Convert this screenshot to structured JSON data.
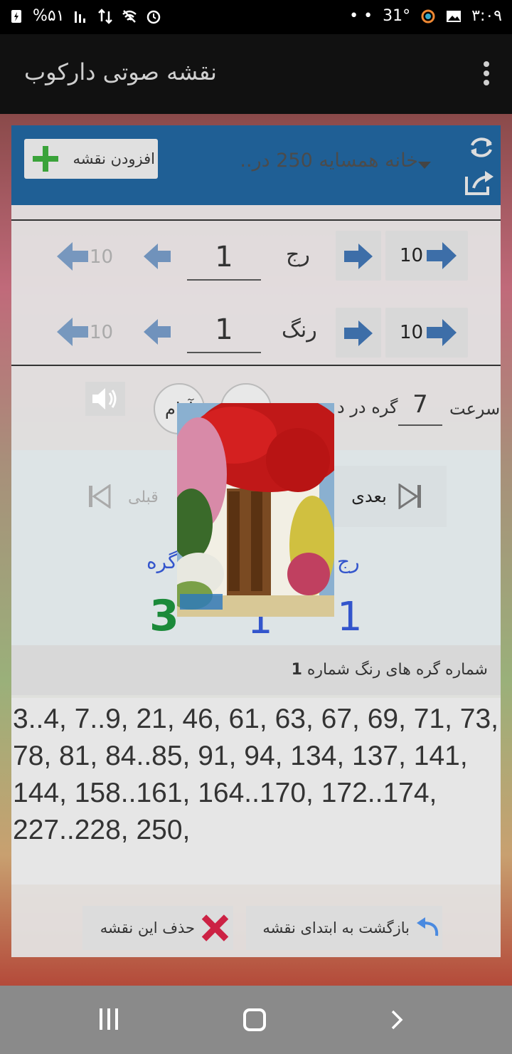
{
  "status_bar": {
    "battery": "%۵۱",
    "time": "۳:۰۹",
    "temperature": "31°",
    "dots": "• •"
  },
  "app_bar": {
    "title": "نقشه صوتی دارکوب"
  },
  "toolbar": {
    "add_map_label": "افزودن نقشه",
    "selected_map": "خانه همسایه  250 در..",
    "accent_color": "#1f5f95"
  },
  "row_control": {
    "label": "رج",
    "value": "1",
    "step_left": "10",
    "step_right": "10"
  },
  "color_control": {
    "label": "رنگ",
    "value": "1",
    "step_left": "10",
    "step_right": "10"
  },
  "speed": {
    "label": "سرعت",
    "value": "7",
    "unit_label": "گره در د",
    "slow_label": "آرام"
  },
  "navigation": {
    "next_label": "بعدی",
    "prev_label": "قبلی"
  },
  "position": {
    "row_heading": "رج",
    "knot_heading": "گره",
    "knot_value": "3",
    "mid_value": "1",
    "row_value": "1"
  },
  "knot_info": {
    "label": "شماره گره های رنگ شماره",
    "color_number": "1"
  },
  "knot_list": {
    "text": "3..4, 7..9, 21, 46, 61, 63, 67, 69, 71, 73, 78, 81, 84..85, 91, 94, 134, 137, 141, 144, 158..161, 164..170, 172..174, 227..228, 250,"
  },
  "footer": {
    "delete_label": "حذف این نقشه",
    "restart_label": "بازگشت به ابتدای نقشه"
  }
}
